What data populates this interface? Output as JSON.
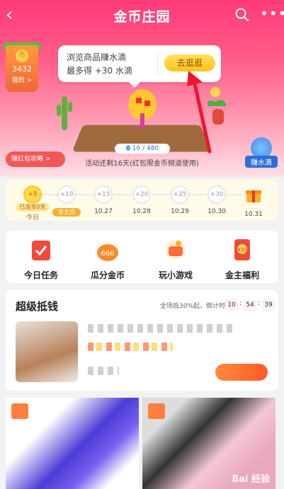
{
  "header": {
    "title": "金币庄园",
    "back_glyph": "‹",
    "more_glyph": "•••"
  },
  "coin": {
    "count": "3432",
    "label": "我的 >",
    "glyph": "币"
  },
  "tip": {
    "line1": "浏览商品赚水滴",
    "line2": "最多得 +30 水滴",
    "button": "去逛逛"
  },
  "progress": {
    "text": "10 / 480",
    "current": 10,
    "total": 480
  },
  "activity_note": "活动还剩16天(红包限金币频道使用)",
  "red_guide": "赚红包攻略 >",
  "water_button": "赚水滴",
  "checkin": {
    "days": [
      {
        "value": "+5",
        "label": "今日",
        "badge": "已连签0天",
        "today": true
      },
      {
        "value": "+10",
        "label": "",
        "badge": "金主日"
      },
      {
        "value": "+15",
        "label": "10.27"
      },
      {
        "value": "+20",
        "label": "10.28"
      },
      {
        "value": "+25",
        "label": "10.29"
      },
      {
        "value": "+30",
        "label": "10.30"
      },
      {
        "value": "",
        "label": "10.31",
        "gift": true
      }
    ]
  },
  "entries": [
    {
      "label": "今日任务",
      "icon": "task-icon",
      "color": "#f24a3a"
    },
    {
      "label": "瓜分金币",
      "icon": "coin-bag-icon",
      "color": "#ff8a2a",
      "badge": "666"
    },
    {
      "label": "玩小游戏",
      "icon": "game-icon",
      "color": "#ff6a3a"
    },
    {
      "label": "金主福利",
      "icon": "red-envelope-icon",
      "color": "#f24a3a",
      "badge": "¥10"
    }
  ],
  "deal": {
    "title": "超级抵钱",
    "subtitle": "全场抵30%起，倒计时:",
    "countdown": [
      "10",
      "54",
      "39"
    ]
  },
  "watermark": "Bai 经验"
}
